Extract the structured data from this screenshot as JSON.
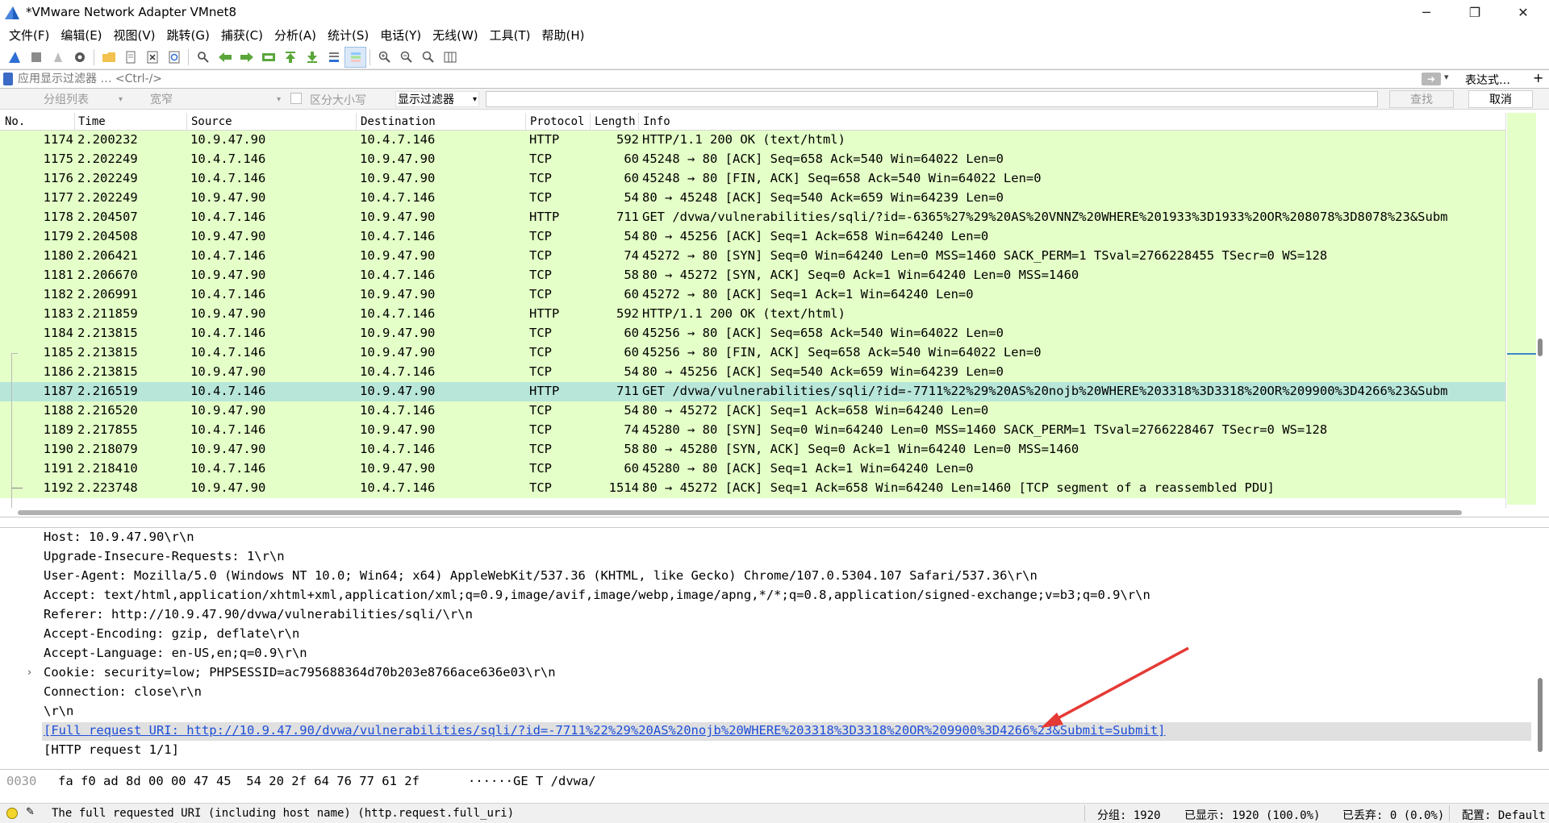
{
  "window": {
    "title": "*VMware Network Adapter VMnet8",
    "controls": [
      "─",
      "❐",
      "✕"
    ]
  },
  "menu": [
    "文件(F)",
    "编辑(E)",
    "视图(V)",
    "跳转(G)",
    "捕获(C)",
    "分析(A)",
    "统计(S)",
    "电话(Y)",
    "无线(W)",
    "工具(T)",
    "帮助(H)"
  ],
  "filterbar": {
    "placeholder": "应用显示过滤器 … <Ctrl-/>",
    "expression_label": "表达式…",
    "plus": "+"
  },
  "findbar": {
    "scope": "分组列表",
    "charset": "宽窄",
    "case_label": "区分大小写",
    "type": "显示过滤器",
    "find_label": "查找",
    "cancel_label": "取消"
  },
  "packet_list": {
    "columns": [
      "No.",
      "Time",
      "Source",
      "Destination",
      "Protocol",
      "Length",
      "Info"
    ],
    "rows": [
      {
        "no": "1174",
        "time": "2.200232",
        "src": "10.9.47.90",
        "dst": "10.4.7.146",
        "proto": "HTTP",
        "len": "592",
        "info": "HTTP/1.1 200 OK  (text/html)"
      },
      {
        "no": "1175",
        "time": "2.202249",
        "src": "10.4.7.146",
        "dst": "10.9.47.90",
        "proto": "TCP",
        "len": "60",
        "info": "45248 → 80 [ACK] Seq=658 Ack=540 Win=64022 Len=0"
      },
      {
        "no": "1176",
        "time": "2.202249",
        "src": "10.4.7.146",
        "dst": "10.9.47.90",
        "proto": "TCP",
        "len": "60",
        "info": "45248 → 80 [FIN, ACK] Seq=658 Ack=540 Win=64022 Len=0"
      },
      {
        "no": "1177",
        "time": "2.202249",
        "src": "10.9.47.90",
        "dst": "10.4.7.146",
        "proto": "TCP",
        "len": "54",
        "info": "80 → 45248 [ACK] Seq=540 Ack=659 Win=64239 Len=0"
      },
      {
        "no": "1178",
        "time": "2.204507",
        "src": "10.4.7.146",
        "dst": "10.9.47.90",
        "proto": "HTTP",
        "len": "711",
        "info": "GET /dvwa/vulnerabilities/sqli/?id=-6365%27%29%20AS%20VNNZ%20WHERE%201933%3D1933%20OR%208078%3D8078%23&Subm"
      },
      {
        "no": "1179",
        "time": "2.204508",
        "src": "10.9.47.90",
        "dst": "10.4.7.146",
        "proto": "TCP",
        "len": "54",
        "info": "80 → 45256 [ACK] Seq=1 Ack=658 Win=64240 Len=0"
      },
      {
        "no": "1180",
        "time": "2.206421",
        "src": "10.4.7.146",
        "dst": "10.9.47.90",
        "proto": "TCP",
        "len": "74",
        "info": "45272 → 80 [SYN] Seq=0 Win=64240 Len=0 MSS=1460 SACK_PERM=1 TSval=2766228455 TSecr=0 WS=128"
      },
      {
        "no": "1181",
        "time": "2.206670",
        "src": "10.9.47.90",
        "dst": "10.4.7.146",
        "proto": "TCP",
        "len": "58",
        "info": "80 → 45272 [SYN, ACK] Seq=0 Ack=1 Win=64240 Len=0 MSS=1460"
      },
      {
        "no": "1182",
        "time": "2.206991",
        "src": "10.4.7.146",
        "dst": "10.9.47.90",
        "proto": "TCP",
        "len": "60",
        "info": "45272 → 80 [ACK] Seq=1 Ack=1 Win=64240 Len=0"
      },
      {
        "no": "1183",
        "time": "2.211859",
        "src": "10.9.47.90",
        "dst": "10.4.7.146",
        "proto": "HTTP",
        "len": "592",
        "info": "HTTP/1.1 200 OK  (text/html)"
      },
      {
        "no": "1184",
        "time": "2.213815",
        "src": "10.4.7.146",
        "dst": "10.9.47.90",
        "proto": "TCP",
        "len": "60",
        "info": "45256 → 80 [ACK] Seq=658 Ack=540 Win=64022 Len=0"
      },
      {
        "no": "1185",
        "time": "2.213815",
        "src": "10.4.7.146",
        "dst": "10.9.47.90",
        "proto": "TCP",
        "len": "60",
        "info": "45256 → 80 [FIN, ACK] Seq=658 Ack=540 Win=64022 Len=0"
      },
      {
        "no": "1186",
        "time": "2.213815",
        "src": "10.9.47.90",
        "dst": "10.4.7.146",
        "proto": "TCP",
        "len": "54",
        "info": "80 → 45256 [ACK] Seq=540 Ack=659 Win=64239 Len=0"
      },
      {
        "no": "1187",
        "time": "2.216519",
        "src": "10.4.7.146",
        "dst": "10.9.47.90",
        "proto": "HTTP",
        "len": "711",
        "info": "GET /dvwa/vulnerabilities/sqli/?id=-7711%22%29%20AS%20nojb%20WHERE%203318%3D3318%20OR%209900%3D4266%23&Subm",
        "selected": true
      },
      {
        "no": "1188",
        "time": "2.216520",
        "src": "10.9.47.90",
        "dst": "10.4.7.146",
        "proto": "TCP",
        "len": "54",
        "info": "80 → 45272 [ACK] Seq=1 Ack=658 Win=64240 Len=0"
      },
      {
        "no": "1189",
        "time": "2.217855",
        "src": "10.4.7.146",
        "dst": "10.9.47.90",
        "proto": "TCP",
        "len": "74",
        "info": "45280 → 80 [SYN] Seq=0 Win=64240 Len=0 MSS=1460 SACK_PERM=1 TSval=2766228467 TSecr=0 WS=128"
      },
      {
        "no": "1190",
        "time": "2.218079",
        "src": "10.9.47.90",
        "dst": "10.4.7.146",
        "proto": "TCP",
        "len": "58",
        "info": "80 → 45280 [SYN, ACK] Seq=0 Ack=1 Win=64240 Len=0 MSS=1460"
      },
      {
        "no": "1191",
        "time": "2.218410",
        "src": "10.4.7.146",
        "dst": "10.9.47.90",
        "proto": "TCP",
        "len": "60",
        "info": "45280 → 80 [ACK] Seq=1 Ack=1 Win=64240 Len=0"
      },
      {
        "no": "1192",
        "time": "2.223748",
        "src": "10.9.47.90",
        "dst": "10.4.7.146",
        "proto": "TCP",
        "len": "1514",
        "info": "80 → 45272 [ACK] Seq=1 Ack=658 Win=64240 Len=1460 [TCP segment of a reassembled PDU]"
      }
    ]
  },
  "details": {
    "lines": [
      "Host: 10.9.47.90\\r\\n",
      "Upgrade-Insecure-Requests: 1\\r\\n",
      "User-Agent: Mozilla/5.0 (Windows NT 10.0; Win64; x64) AppleWebKit/537.36 (KHTML, like Gecko) Chrome/107.0.5304.107 Safari/537.36\\r\\n",
      "Accept: text/html,application/xhtml+xml,application/xml;q=0.9,image/avif,image/webp,image/apng,*/*;q=0.8,application/signed-exchange;v=b3;q=0.9\\r\\n",
      "Referer: http://10.9.47.90/dvwa/vulnerabilities/sqli/\\r\\n",
      "Accept-Encoding: gzip, deflate\\r\\n",
      "Accept-Language: en-US,en;q=0.9\\r\\n",
      "Cookie: security=low; PHPSESSID=ac795688364d70b203e8766ace636e03\\r\\n",
      "Connection: close\\r\\n",
      "\\r\\n",
      "[Full request URI: http://10.9.47.90/dvwa/vulnerabilities/sqli/?id=-7711%22%29%20AS%20nojb%20WHERE%203318%3D3318%20OR%209900%3D4266%23&Submit=Submit]",
      "[HTTP request 1/1]"
    ],
    "expander": "›"
  },
  "bytes": {
    "offset": "0030",
    "hex": "fa f0 ad 8d 00 00 47 45  54 20 2f 64 76 77 61 2f",
    "ascii": "······GE T /dvwa/"
  },
  "status": {
    "message": "The full requested URI (including host name) (http.request.full_uri)",
    "packets": "分组: 1920",
    "displayed": "已显示: 1920 (100.0%)",
    "dropped": "已丢弃: 0 (0.0%)",
    "profile": "配置: Default"
  },
  "colors": {
    "row_bg": "#e4ffc7",
    "selected_bg": "#b8e6d9",
    "link": "#1d4ed8",
    "annotation_arrow": "#e53935"
  }
}
